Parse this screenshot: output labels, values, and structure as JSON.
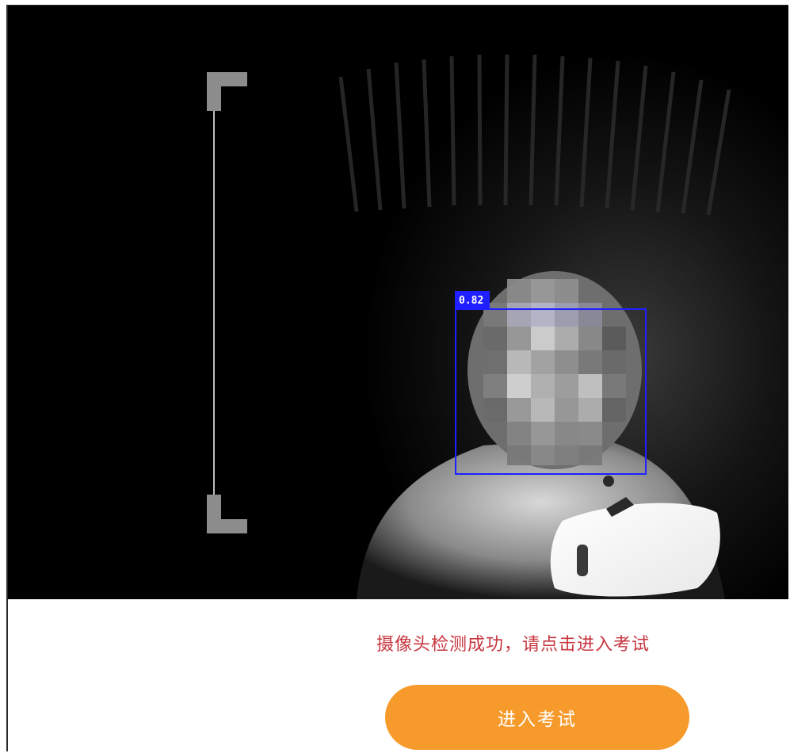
{
  "camera_preview": {
    "detection": {
      "confidence_label": "0.82",
      "box_color": "#1f1fff"
    },
    "guide_bracket_color": "#8c8c8c"
  },
  "status_message": "摄像头检测成功，请点击进入考试",
  "enter_button_label": "进入考试",
  "colors": {
    "status_text": "#c7363f",
    "button_bg": "#f79a2c",
    "button_text": "#ffffff"
  }
}
